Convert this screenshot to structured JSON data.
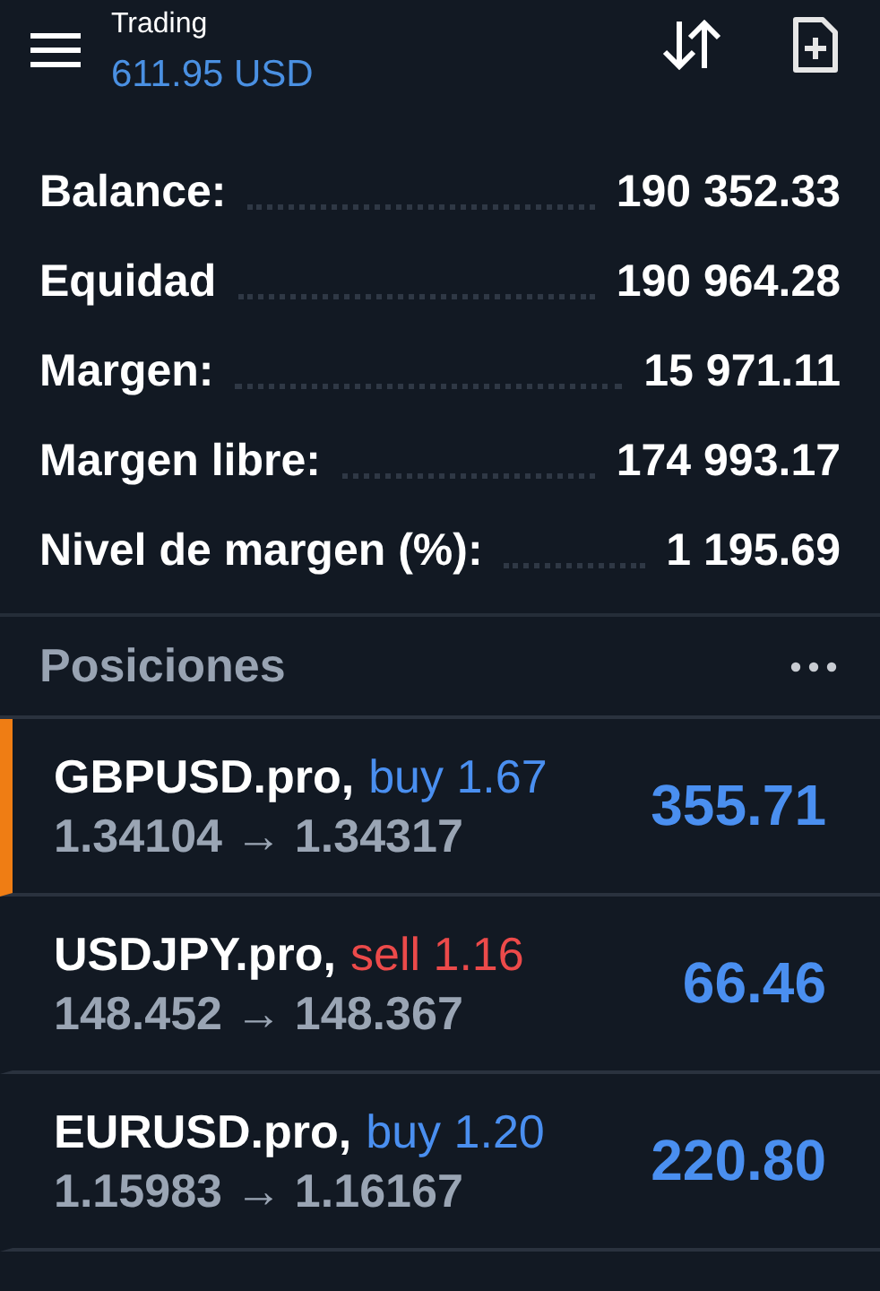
{
  "header": {
    "title": "Trading",
    "subtitle": "611.95 USD"
  },
  "account": [
    {
      "label": "Balance:",
      "value": "190 352.33"
    },
    {
      "label": "Equidad",
      "value": "190 964.28"
    },
    {
      "label": "Margen:",
      "value": "15 971.11"
    },
    {
      "label": "Margen libre:",
      "value": "174 993.17"
    },
    {
      "label": "Nivel de margen (%):",
      "value": "1 195.69"
    }
  ],
  "positions_title": "Posiciones",
  "positions": [
    {
      "symbol": "GBPUSD.pro,",
      "kind": "buy",
      "order": "buy 1.67",
      "prices": "1.34104 → 1.34317",
      "profit": "355.71",
      "selected": true
    },
    {
      "symbol": "USDJPY.pro,",
      "kind": "sell",
      "order": "sell 1.16",
      "prices": "148.452 → 148.367",
      "profit": "66.46",
      "selected": false
    },
    {
      "symbol": "EURUSD.pro,",
      "kind": "buy",
      "order": "buy 1.20",
      "prices": "1.15983 → 1.16167",
      "profit": "220.80",
      "selected": false
    }
  ]
}
